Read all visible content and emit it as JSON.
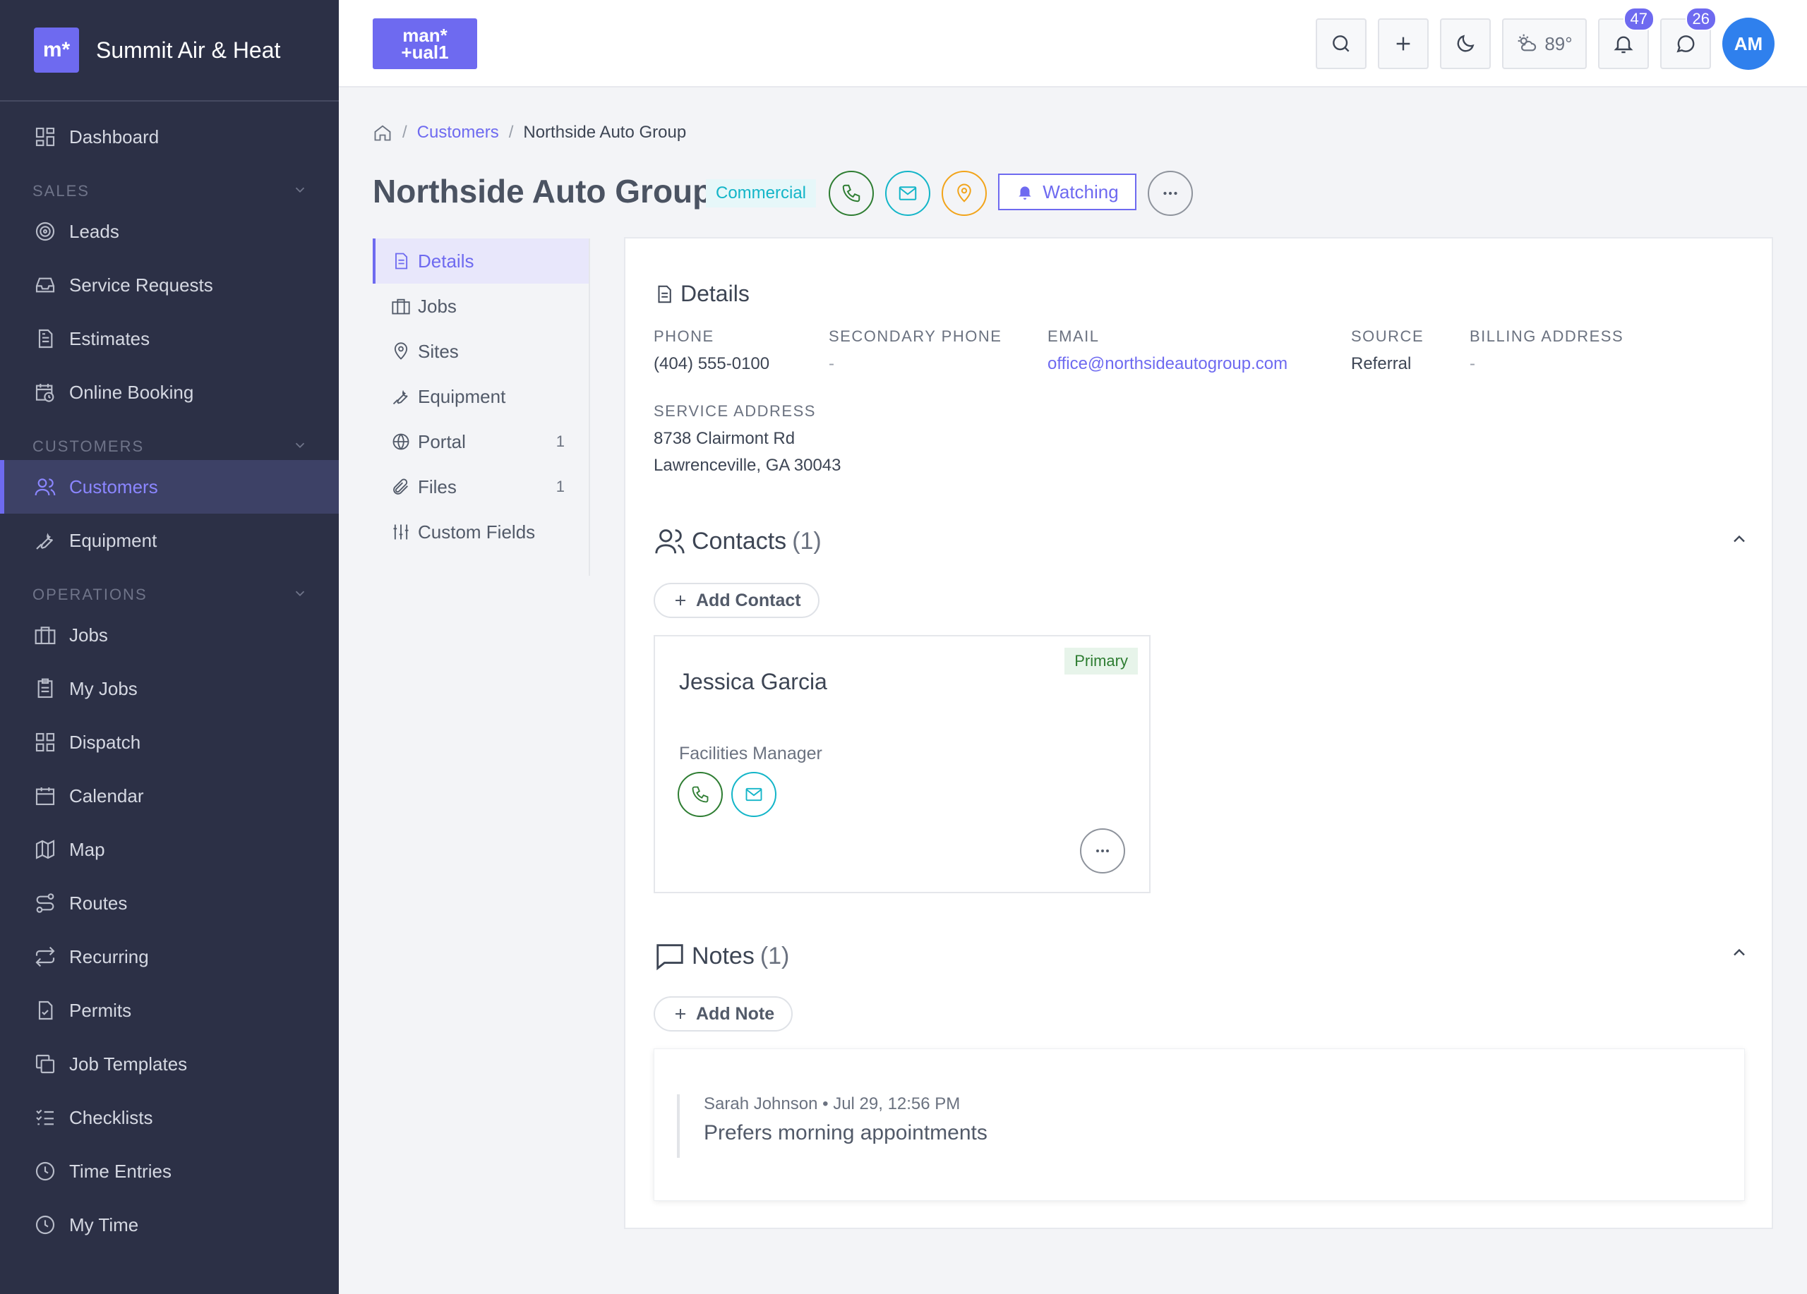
{
  "brand": {
    "logo": "m*",
    "name": "Summit Air & Heat"
  },
  "sidebar": {
    "items": [
      {
        "label": "Dashboard",
        "icon": "dashboard-icon"
      },
      {
        "section": "SALES"
      },
      {
        "label": "Leads",
        "icon": "target-icon"
      },
      {
        "label": "Service Requests",
        "icon": "inbox-icon"
      },
      {
        "label": "Estimates",
        "icon": "document-icon"
      },
      {
        "label": "Online Booking",
        "icon": "calendar-clock-icon"
      },
      {
        "section": "CUSTOMERS"
      },
      {
        "label": "Customers",
        "icon": "users-icon",
        "active": true
      },
      {
        "label": "Equipment",
        "icon": "wrench-icon"
      },
      {
        "section": "OPERATIONS"
      },
      {
        "label": "Jobs",
        "icon": "briefcase-icon"
      },
      {
        "label": "My Jobs",
        "icon": "clipboard-icon"
      },
      {
        "label": "Dispatch",
        "icon": "grid-icon"
      },
      {
        "label": "Calendar",
        "icon": "calendar-icon"
      },
      {
        "label": "Map",
        "icon": "map-icon"
      },
      {
        "label": "Routes",
        "icon": "route-icon"
      },
      {
        "label": "Recurring",
        "icon": "repeat-icon"
      },
      {
        "label": "Permits",
        "icon": "permit-icon"
      },
      {
        "label": "Job Templates",
        "icon": "copy-icon"
      },
      {
        "label": "Checklists",
        "icon": "checklist-icon"
      },
      {
        "label": "Time Entries",
        "icon": "clock-icon"
      },
      {
        "label": "My Time",
        "icon": "clock-icon"
      }
    ]
  },
  "topbar": {
    "logo": "man*\n+ual1",
    "weather": "89°",
    "notifications_count": "47",
    "messages_count": "26",
    "avatar_initials": "AM"
  },
  "breadcrumb": {
    "parent": "Customers",
    "current": "Northside Auto Group"
  },
  "customer": {
    "name": "Northside Auto Group",
    "type_tag": "Commercial",
    "watch_label": "Watching"
  },
  "subnav": [
    {
      "label": "Details",
      "icon": "document-icon",
      "active": true,
      "count": ""
    },
    {
      "label": "Jobs",
      "icon": "briefcase-icon",
      "count": ""
    },
    {
      "label": "Sites",
      "icon": "pin-icon",
      "count": ""
    },
    {
      "label": "Equipment",
      "icon": "wrench-icon",
      "count": ""
    },
    {
      "label": "Portal",
      "icon": "globe-icon",
      "count": "1"
    },
    {
      "label": "Files",
      "icon": "paperclip-icon",
      "count": "1"
    },
    {
      "label": "Custom Fields",
      "icon": "sliders-icon",
      "count": ""
    }
  ],
  "details": {
    "title": "Details",
    "phone_label": "PHONE",
    "phone": "(404) 555-0100",
    "secondary_phone_label": "SECONDARY PHONE",
    "secondary_phone": "-",
    "email_label": "EMAIL",
    "email": "office@northsideautogroup.com",
    "source_label": "SOURCE",
    "source": "Referral",
    "billing_label": "BILLING ADDRESS",
    "billing": "-",
    "service_label": "SERVICE ADDRESS",
    "service_line1": "8738 Clairmont Rd",
    "service_line2": "Lawrenceville, GA 30043"
  },
  "contacts": {
    "title": "Contacts",
    "count": "(1)",
    "add_label": "Add Contact",
    "items": [
      {
        "name": "Jessica Garcia",
        "role": "Facilities Manager",
        "tag": "Primary"
      }
    ]
  },
  "notes": {
    "title": "Notes",
    "count": "(1)",
    "add_label": "Add Note",
    "items": [
      {
        "meta": "Sarah Johnson • Jul 29, 12:56 PM",
        "text": "Prefers morning appointments"
      }
    ]
  }
}
